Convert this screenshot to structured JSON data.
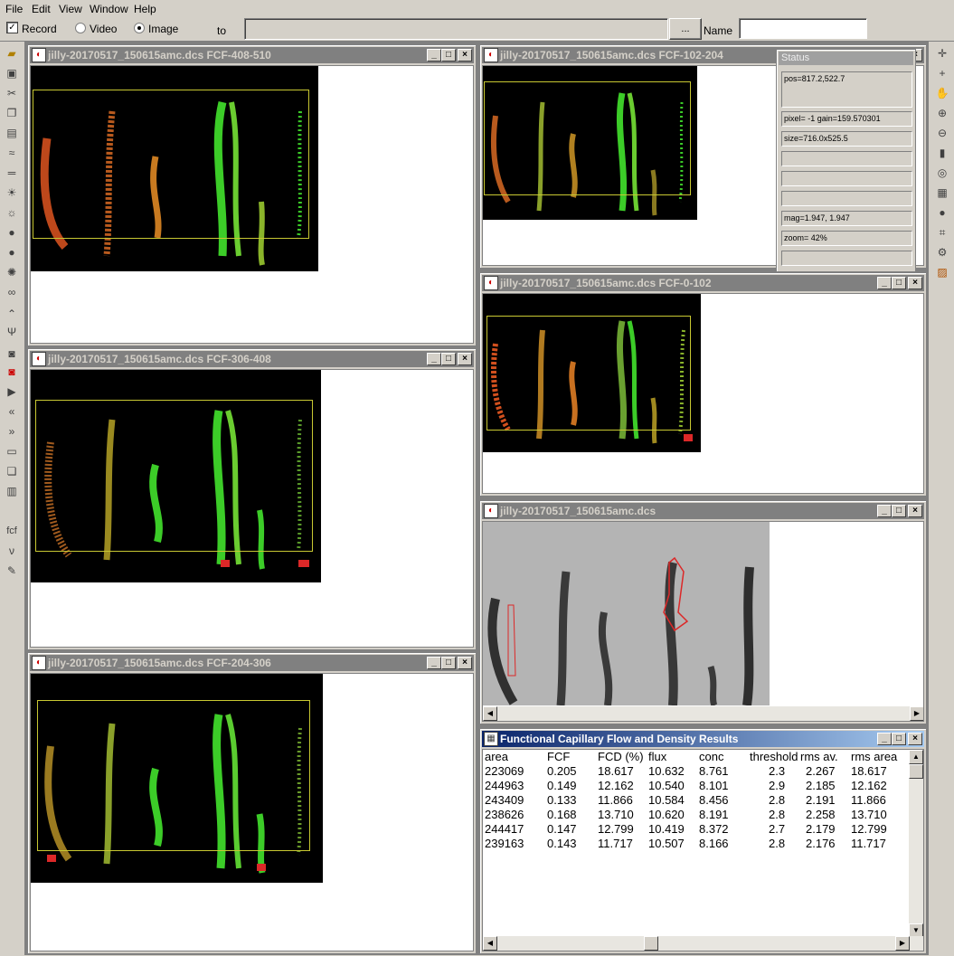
{
  "menu": [
    "File",
    "Edit",
    "View",
    "Window",
    "Help"
  ],
  "toolbar": {
    "record_label": "Record",
    "record_checked": true,
    "video_label": "Video",
    "image_label": "Image",
    "to_label": "to",
    "browse_label": "...",
    "name_label": "Name",
    "name_value": ""
  },
  "windows": {
    "w1": {
      "title": "jilly-20170517_150615amc.dcs FCF-408-510"
    },
    "w2": {
      "title": "jilly-20170517_150615amc.dcs FCF-306-408"
    },
    "w3": {
      "title": "jilly-20170517_150615amc.dcs FCF-204-306"
    },
    "w4": {
      "title": "jilly-20170517_150615amc.dcs FCF-102-204"
    },
    "w5": {
      "title": "jilly-20170517_150615amc.dcs FCF-0-102"
    },
    "w6": {
      "title": "jilly-20170517_150615amc.dcs"
    },
    "results": {
      "title": "Functional Capillary Flow and Density Results"
    }
  },
  "status": {
    "title": "Status",
    "pos": "pos=817.2,522.7",
    "pixel": "pixel= -1 gain=159.570301",
    "size": "size=716.0x525.5",
    "mag": "mag=1.947, 1.947",
    "zoom": "zoom=  42%"
  },
  "results": {
    "headers": [
      "area",
      "FCF",
      "FCD (%)",
      "flux",
      "conc",
      "threshold",
      "rms av.",
      "rms area"
    ],
    "rows": [
      [
        "223069",
        "0.205",
        "18.617",
        "10.632",
        "8.761",
        "2.3",
        "2.267",
        "18.617"
      ],
      [
        "244963",
        "0.149",
        "12.162",
        "10.540",
        "8.101",
        "2.9",
        "2.185",
        "12.162"
      ],
      [
        "243409",
        "0.133",
        "11.866",
        "10.584",
        "8.456",
        "2.8",
        "2.191",
        "11.866"
      ],
      [
        "238626",
        "0.168",
        "13.710",
        "10.620",
        "8.191",
        "2.8",
        "2.258",
        "13.710"
      ],
      [
        "244417",
        "0.147",
        "12.799",
        "10.419",
        "8.372",
        "2.7",
        "2.179",
        "12.799"
      ],
      [
        "239163",
        "0.143",
        "11.717",
        "10.507",
        "8.166",
        "2.8",
        "2.176",
        "11.717"
      ]
    ]
  },
  "colors": {
    "flow_green": "#3ccc28",
    "flow_orange": "#d2501e",
    "roi_yellow": "#c8c832",
    "trace_red": "#dc2828",
    "active_title": "#0a246a"
  },
  "icons": {
    "left": [
      "open-folder-icon",
      "save-icon",
      "cut-icon",
      "copy-icon",
      "paste-icon",
      "wave-icon",
      "equals-icon",
      "brightness-icon",
      "contrast-icon",
      "circle-icon",
      "circle-small-icon",
      "gear-icon",
      "glasses-icon",
      "peak-icon",
      "split-icon",
      "camera-icon",
      "record-camera-icon",
      "play-icon",
      "rewind-icon",
      "fast-forward-icon",
      "tape-icon",
      "stack-icon",
      "frames-icon",
      "fcf-text-icon",
      "v-icon",
      "pen-icon"
    ],
    "right": [
      "crosshair-icon",
      "plus-icon",
      "hand-icon",
      "zoom-in-icon",
      "zoom-out-icon",
      "trash-icon",
      "target-icon",
      "grid-icon",
      "circle-fill-icon",
      "nodes-icon",
      "tool-icon",
      "image-icon"
    ]
  }
}
